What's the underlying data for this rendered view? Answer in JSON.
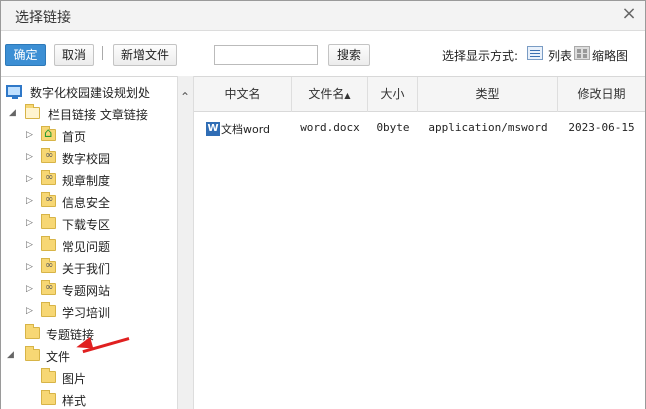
{
  "dialog": {
    "title": "选择链接",
    "close_glyph": "×"
  },
  "toolbar": {
    "confirm": "确定",
    "cancel": "取消",
    "separator": "|",
    "new_file": "新增文件",
    "search_value": "",
    "search": "搜索",
    "display_mode_label": "选择显示方式:",
    "list_mode": "列表",
    "thumb_mode": "缩略图"
  },
  "tree": {
    "root": "数字化校园建设规划处",
    "group": "栏目链接 文章链接",
    "items": [
      {
        "label": "首页",
        "icon": "home-folder-icon"
      },
      {
        "label": "数字校园",
        "icon": "link-folder-icon"
      },
      {
        "label": "规章制度",
        "icon": "link-folder-icon"
      },
      {
        "label": "信息安全",
        "icon": "link-folder-icon"
      },
      {
        "label": "下载专区",
        "icon": "folder-icon"
      },
      {
        "label": "常见问题",
        "icon": "folder-icon"
      },
      {
        "label": "关于我们",
        "icon": "link-folder-icon"
      },
      {
        "label": "专题网站",
        "icon": "link-folder-icon"
      },
      {
        "label": "学习培训",
        "icon": "folder-icon"
      }
    ],
    "topic_links": "专题链接",
    "files": "文件",
    "file_children": [
      "图片",
      "样式"
    ]
  },
  "table": {
    "columns": [
      "中文名",
      "文件名",
      "大小",
      "类型",
      "修改日期"
    ],
    "sort_glyph": "▲",
    "rows": [
      {
        "cn_name": "文档word",
        "file_name": "word.docx",
        "size": "0byte",
        "type": "application/msword",
        "date": "2023-06-15"
      }
    ]
  },
  "colors": {
    "primary_button": "#3c8fd4",
    "annotation_arrow": "#e02020"
  }
}
